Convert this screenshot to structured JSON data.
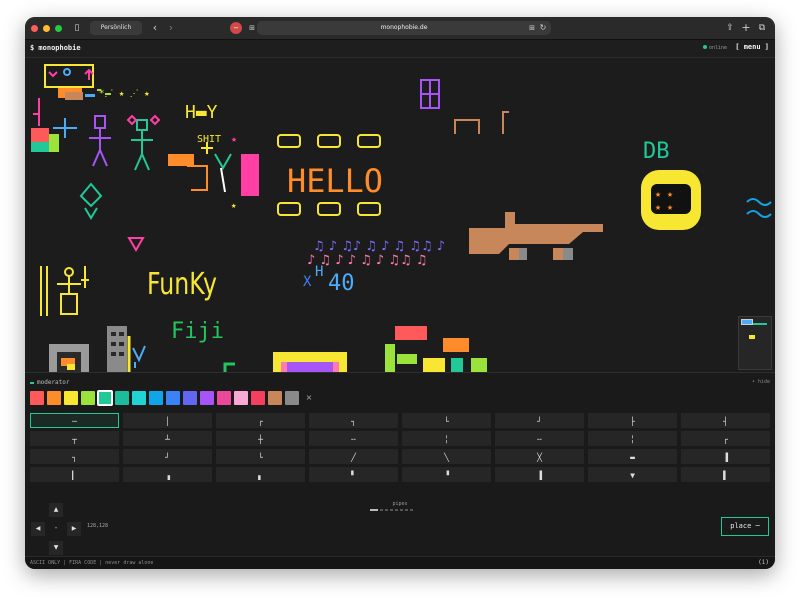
{
  "browser": {
    "profile_label": "Persönlich",
    "url": "monophobie.de",
    "back_glyph": "‹",
    "forward_glyph": "›",
    "sidebar_glyph": "▯",
    "share_glyph": "⇪",
    "newtab_glyph": "+",
    "tabs_glyph": "⧉",
    "reload_glyph": "↻",
    "translate_glyph": "⊞",
    "stop_glyph": "−",
    "window_buttons": [
      "#ff5f57",
      "#febc2e",
      "#28c840"
    ]
  },
  "app": {
    "logo": "$ monophobie",
    "status": "online",
    "menu_label": "[ menu ]"
  },
  "canvas": {
    "drawings": [
      {
        "text": "H▬Y",
        "color": "#f7e733"
      },
      {
        "text": "SHIT",
        "color": "#ff3fa4"
      },
      {
        "text": "HELLO",
        "color": "#ff8c2a"
      },
      {
        "text": "FunKy",
        "color": "#f7e733"
      },
      {
        "text": "DB",
        "color": "#20c997"
      },
      {
        "text": "H",
        "color": "#4dabf7"
      },
      {
        "text": "40",
        "color": "#4dabf7"
      },
      {
        "text": "X",
        "color": "#3b82f6"
      },
      {
        "text": "Fiji",
        "color": "#22c55e"
      },
      {
        "text": "♫ ♪ ♫♪ ♫ ♪ ♫ ♫♫ ♪",
        "color": "#7c6cff"
      },
      {
        "text": "♪ ♫ ♪  ♪ ♫ ♪ ♫♫ ♫",
        "color": "#ff7ab0"
      }
    ],
    "minimap_label": "minimap"
  },
  "panel": {
    "title": "moderator",
    "hide_label": "• hide",
    "swatch_close": "×",
    "selected_swatch": 4,
    "selected_cell": 0,
    "set_name": "pipes",
    "pages": 8,
    "current_page": 0,
    "coords": "128,128",
    "place_label": "place ─"
  },
  "colors": [
    "#ff5a5a",
    "#ff8c2a",
    "#f7e733",
    "#9be33a",
    "#20c997",
    "#1abc9c",
    "#22d3d3",
    "#0ea5e9",
    "#3b82f6",
    "#6366f1",
    "#a855f7",
    "#ec4899",
    "#f9a8d4",
    "#f43f5e",
    "#c8875a",
    "#8a8a8a"
  ],
  "glyphs": [
    "─",
    "│",
    "┌",
    "┐",
    "└",
    "┘",
    "├",
    "┤",
    "┬",
    "┴",
    "┼",
    "╌",
    "╎",
    "╌",
    "╎",
    "┌",
    "┐",
    "┘",
    "└",
    "╱",
    "╲",
    "╳",
    "▬",
    "▐",
    "▎",
    "▗",
    "▖",
    "▘",
    "▝",
    "▐",
    "▼",
    "▌"
  ],
  "dpad": {
    "up": "▲",
    "left": "◀",
    "center": "•",
    "right": "▶",
    "down": "▼"
  },
  "footer": {
    "text": "ASCII ONLY | FIRA CODE | never draw alone",
    "info": "(i)"
  },
  "accent": "#20c997"
}
